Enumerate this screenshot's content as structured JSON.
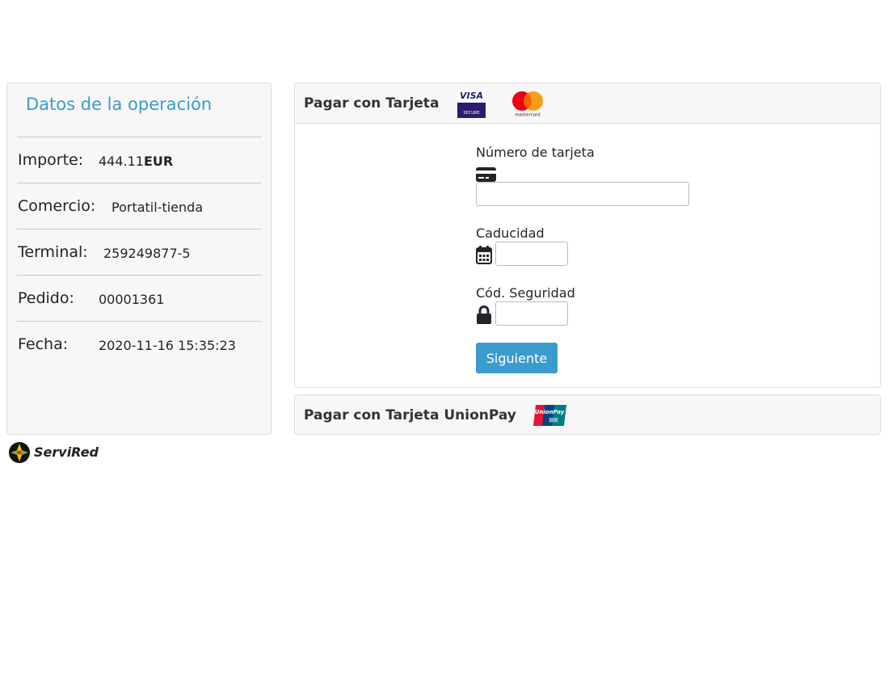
{
  "operation": {
    "title": "Datos de la operación",
    "rows": [
      {
        "label": "Importe:",
        "value": "444.11",
        "value_suffix": "EUR"
      },
      {
        "label": "Comercio:",
        "value": "Portatil-tienda"
      },
      {
        "label": "Terminal:",
        "value": "259249877-5"
      },
      {
        "label": "Pedido:",
        "value": "00001361"
      },
      {
        "label": "Fecha:",
        "value": "2020-11-16 15:35:23"
      }
    ]
  },
  "card_payment": {
    "title": "Pagar con Tarjeta",
    "logos": [
      "visa-secure-logo",
      "mastercard-logo"
    ],
    "visa_text": "VISA",
    "visa_sub": "SECURE",
    "mastercard_text": "mastercard",
    "card_number": {
      "label": "Número de tarjeta",
      "value": "",
      "icon": "credit-card-icon"
    },
    "expiry": {
      "label": "Caducidad",
      "value": "",
      "icon": "calendar-icon"
    },
    "cvv": {
      "label": "Cód. Seguridad",
      "value": "",
      "icon": "lock-icon"
    },
    "submit_label": "Siguiente"
  },
  "unionpay": {
    "title": "Pagar con Tarjeta UnionPay",
    "logo_text": "UnionPay",
    "logo_sub": "银联"
  },
  "footer": {
    "brand": "ServiRed"
  },
  "colors": {
    "accent": "#3a9ccc",
    "panel_bg": "#f7f7f7",
    "border": "#dcdcdc"
  }
}
